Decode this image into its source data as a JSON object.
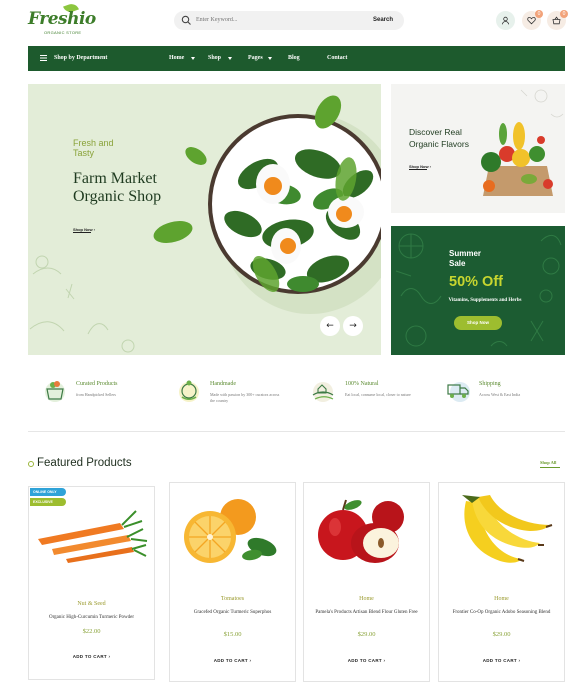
{
  "header": {
    "logo_text": "Freshio",
    "logo_sub": "ORGANIC STORE",
    "search_placeholder": "Enter Keyword...",
    "search_button": "Search",
    "wishlist_count": "0",
    "cart_count": "0"
  },
  "nav": {
    "department": "Shop by Department",
    "items": [
      {
        "label": "Home",
        "dropdown": true
      },
      {
        "label": "Shop",
        "dropdown": true
      },
      {
        "label": "Pages",
        "dropdown": true
      },
      {
        "label": "Blog",
        "dropdown": false
      },
      {
        "label": "Contact",
        "dropdown": false
      }
    ]
  },
  "hero": {
    "subtitle": "Fresh and Tasty",
    "title": "Farm Market Organic Shop",
    "link": "Shop Now"
  },
  "banner_top": {
    "title": "Discover Real Organic Flavors",
    "link": "Shop Now"
  },
  "banner_bottom": {
    "subtitle": "Summer Sale",
    "highlight": "50% Off",
    "desc": "Vitamins, Supplements and Herbs",
    "button": "Shop Now"
  },
  "features": [
    {
      "title": "Curated Products",
      "desc": "from Handpicked Sellers",
      "icon": "basket-icon"
    },
    {
      "title": "Handmade",
      "desc": "Made with passion by 300+ curators across the country",
      "icon": "handmade-icon"
    },
    {
      "title": "100% Natural",
      "desc": "Eat local, consume local, closer to nature",
      "icon": "farm-icon"
    },
    {
      "title": "Shipping",
      "desc": "Across West & East India",
      "icon": "truck-icon"
    }
  ],
  "featured": {
    "title": "Featured Products",
    "shop_all": "Shop All"
  },
  "products": [
    {
      "tag1": "ONLINE ONLY",
      "tag2": "EXCLUSIVE",
      "category": "Nut & Seed",
      "name": "Organic High-Curcumin Turmeric Powder",
      "price": "$22.00",
      "cart": "ADD TO CART"
    },
    {
      "category": "Tomatoes",
      "name": "Gracefed Organic Turmeric Superphos",
      "price": "$15.00",
      "cart": "ADD TO CART"
    },
    {
      "category": "Home",
      "name": "Pamela's Products Artisan Blend Flour Gluten Free",
      "price": "$29.00",
      "cart": "ADD TO CART"
    },
    {
      "category": "Home",
      "name": "Frontier Co-Op Organic Adobo Seasoning Blend",
      "price": "$29.00",
      "cart": "ADD TO CART"
    }
  ],
  "colors": {
    "brand_green": "#1d5a2d",
    "accent": "#9dbd2f",
    "highlight": "#c8d62f"
  }
}
